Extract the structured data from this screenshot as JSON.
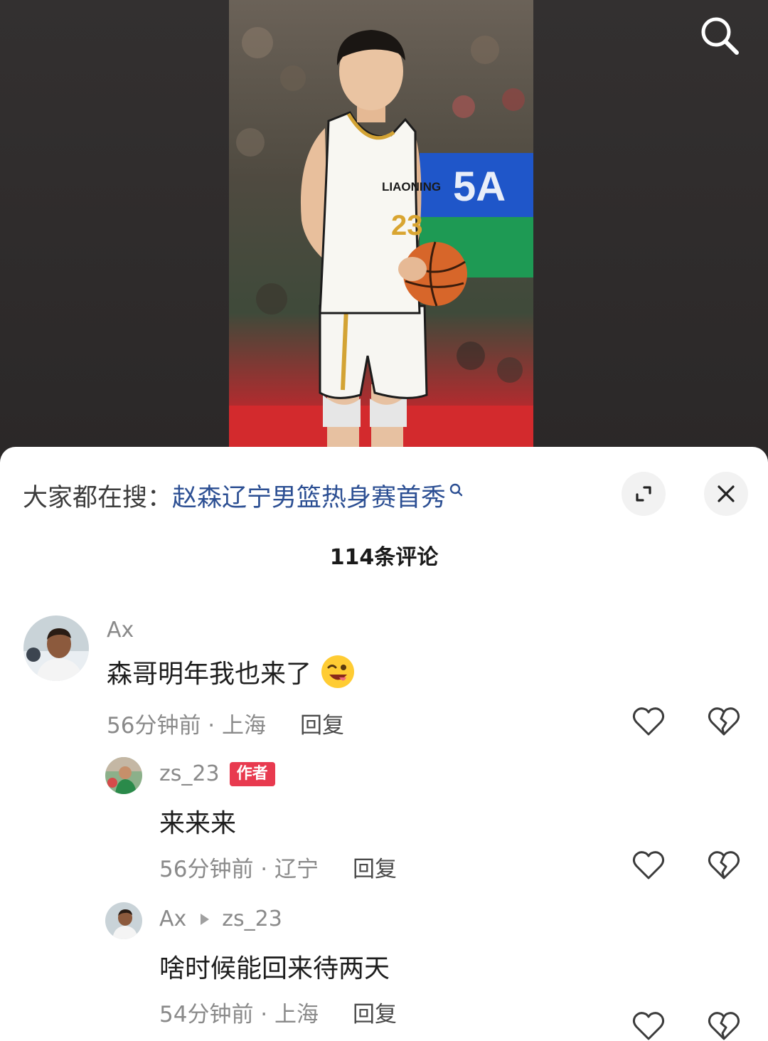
{
  "hot_search": {
    "prefix": "大家都在搜：",
    "query": "赵森辽宁男篮热身赛首秀"
  },
  "comments_count": "114条评论",
  "photo": {
    "jersey_text": "LIAONING",
    "jersey_number": "23",
    "banner_text": "5A"
  },
  "comments": [
    {
      "user": "Ax",
      "text": "森哥明年我也来了",
      "emoji": "😜",
      "time": "56分钟前 · 上海",
      "reply": "回复"
    }
  ],
  "replies": [
    {
      "user": "zs_23",
      "badge": "作者",
      "text": "来来来",
      "time": "56分钟前 · 辽宁",
      "reply": "回复"
    },
    {
      "user": "Ax",
      "reply_to": "zs_23",
      "text": "啥时候能回来待两天",
      "time": "54分钟前 · 上海",
      "reply": "回复"
    }
  ],
  "colors": {
    "link_blue": "#2c4f93",
    "author_badge": "#e83a4f",
    "sheet_bg": "#ffffff",
    "video_bg": "#2b2828"
  },
  "icons": [
    "search-icon",
    "expand-icon",
    "close-icon",
    "like-icon",
    "dislike-icon"
  ]
}
